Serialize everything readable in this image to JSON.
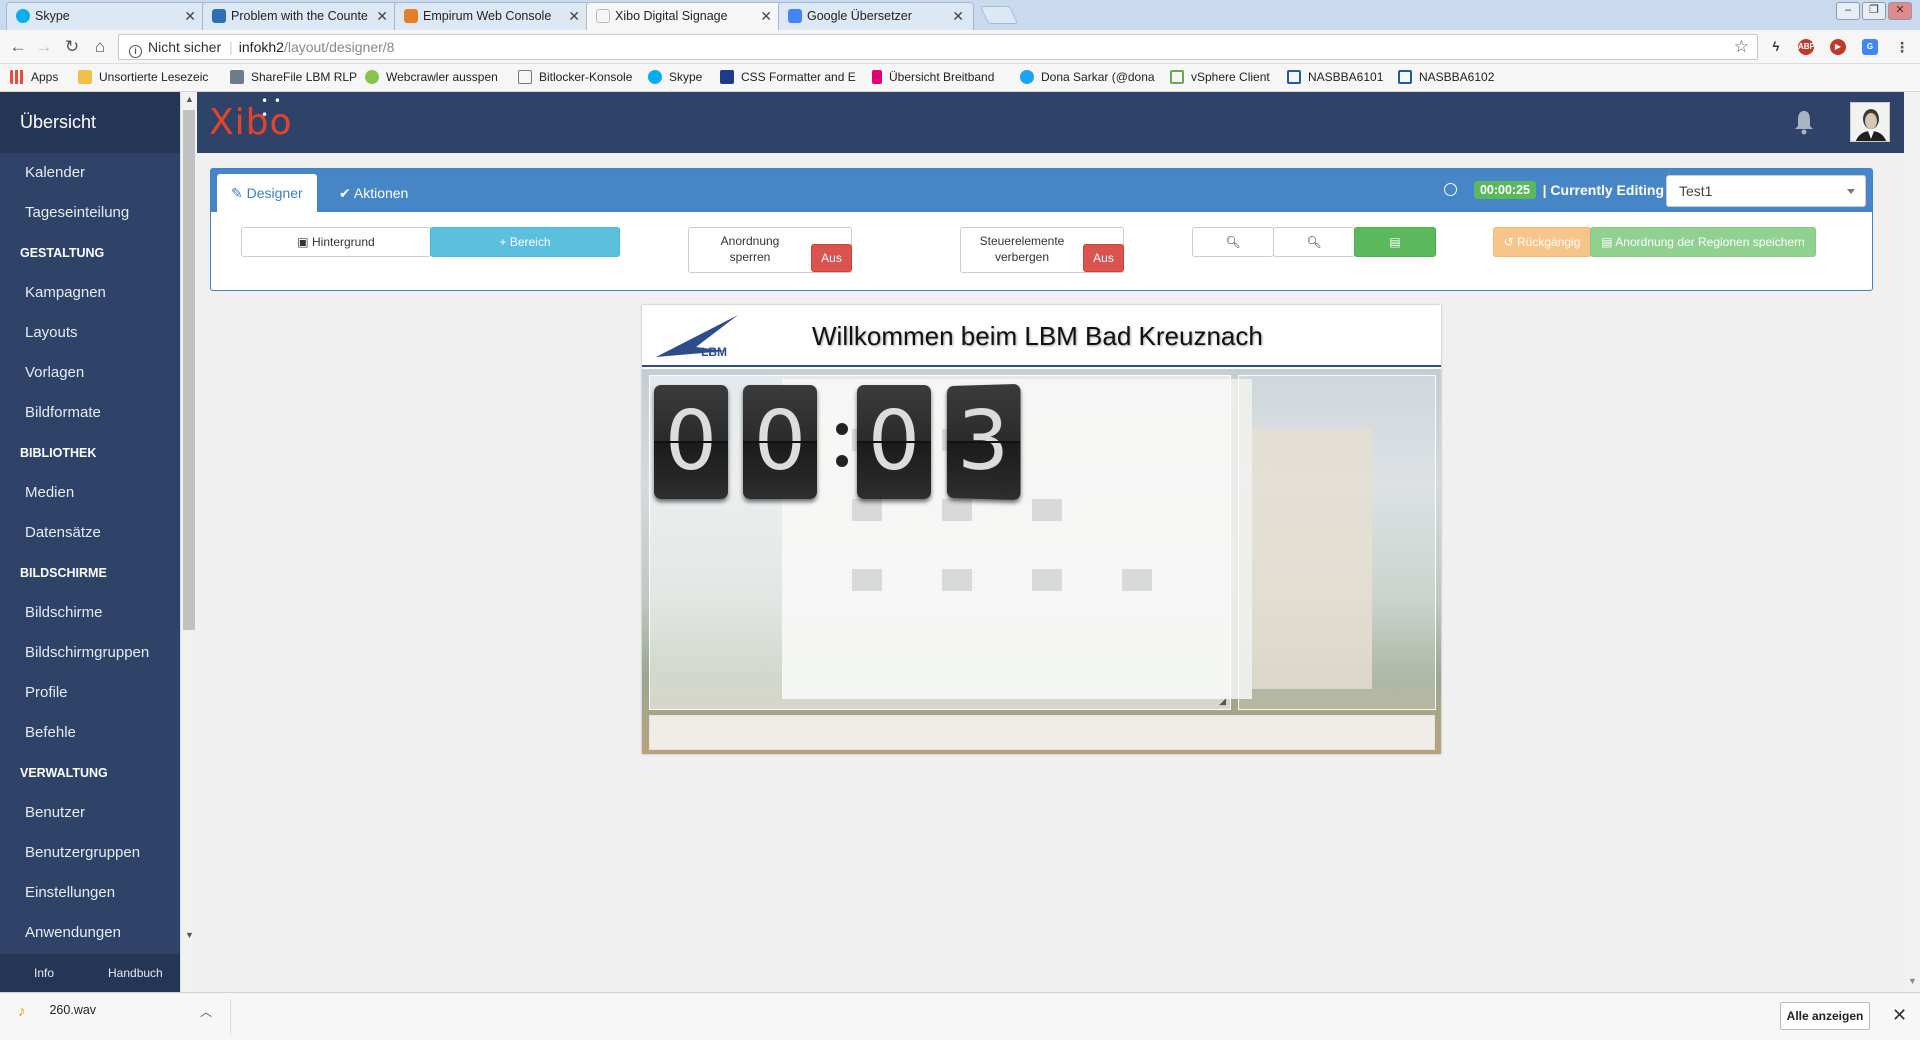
{
  "browser": {
    "tabs": [
      {
        "title": "Skype",
        "favicon_color": "#00aff0"
      },
      {
        "title": "Problem with the Counte",
        "favicon_color": "#2c6fb7"
      },
      {
        "title": "Empirum Web Console",
        "favicon_color": "#e57e25"
      },
      {
        "title": "Xibo Digital Signage",
        "favicon_color": "#e2452b"
      },
      {
        "title": "Google Übersetzer",
        "favicon_color": "#4285f4"
      }
    ],
    "close_glyph": "✕",
    "address": {
      "security_label": "Nicht sicher",
      "host": "infokh2",
      "path": "/layout/designer/8"
    },
    "bookmarks": [
      "Apps",
      "Unsortierte Lesezeic",
      "ShareFile LBM RLP",
      "Webcrawler ausspen",
      "Bitlocker-Konsole",
      "Skype",
      "CSS Formatter and E",
      "Übersicht Breitband",
      "Dona Sarkar (@dona",
      "vSphere Client",
      "NASBBA6101",
      "NASBBA6102"
    ]
  },
  "sidebar": {
    "brand": "Übersicht",
    "items": [
      {
        "type": "item",
        "label": "Kalender"
      },
      {
        "type": "item",
        "label": "Tageseinteilung"
      },
      {
        "type": "head",
        "label": "GESTALTUNG"
      },
      {
        "type": "item",
        "label": "Kampagnen"
      },
      {
        "type": "item",
        "label": "Layouts"
      },
      {
        "type": "item",
        "label": "Vorlagen"
      },
      {
        "type": "item",
        "label": "Bildformate"
      },
      {
        "type": "head",
        "label": "BIBLIOTHEK"
      },
      {
        "type": "item",
        "label": "Medien"
      },
      {
        "type": "item",
        "label": "Datensätze"
      },
      {
        "type": "head",
        "label": "BILDSCHIRME"
      },
      {
        "type": "item",
        "label": "Bildschirme"
      },
      {
        "type": "item",
        "label": "Bildschirmgruppen"
      },
      {
        "type": "item",
        "label": "Profile"
      },
      {
        "type": "item",
        "label": "Befehle"
      },
      {
        "type": "head",
        "label": "VERWALTUNG"
      },
      {
        "type": "item",
        "label": "Benutzer"
      },
      {
        "type": "item",
        "label": "Benutzergruppen"
      },
      {
        "type": "item",
        "label": "Einstellungen"
      },
      {
        "type": "item",
        "label": "Anwendungen"
      }
    ],
    "footer": {
      "info": "Info",
      "manual": "Handbuch"
    }
  },
  "header": {
    "logo_text": "Xibo"
  },
  "designer": {
    "tabs": {
      "designer": "Designer",
      "actions": "Aktionen"
    },
    "duration": "00:00:25",
    "currently_editing_label": "| Currently Editing",
    "layout_name": "Test1",
    "toolbar": {
      "background_label": "Hintergrund",
      "region_label": "+ Bereich",
      "lock_label_1": "Anordnung",
      "lock_label_2": "sperren",
      "lock_state": "Aus",
      "hide_controls_label_1": "Steuerelemente",
      "hide_controls_label_2": "verbergen",
      "hide_controls_state": "Aus",
      "undo_label": "Rückgängig",
      "save_regions_label": "Anordnung der Regionen speichern"
    },
    "colors": {
      "primary": "#4685c6",
      "success": "#5cb85c",
      "danger": "#d9534f",
      "sidebar": "#2f4268"
    }
  },
  "canvas": {
    "logo_text": "LBM",
    "welcome_text": "Willkommen beim LBM Bad Kreuznach",
    "clock_digits": [
      "0",
      "0",
      "0",
      "3"
    ],
    "clock_separator": ":"
  },
  "downloads": {
    "file_name": "260.wav",
    "show_all_label": "Alle anzeigen",
    "close_glyph": "✕"
  }
}
